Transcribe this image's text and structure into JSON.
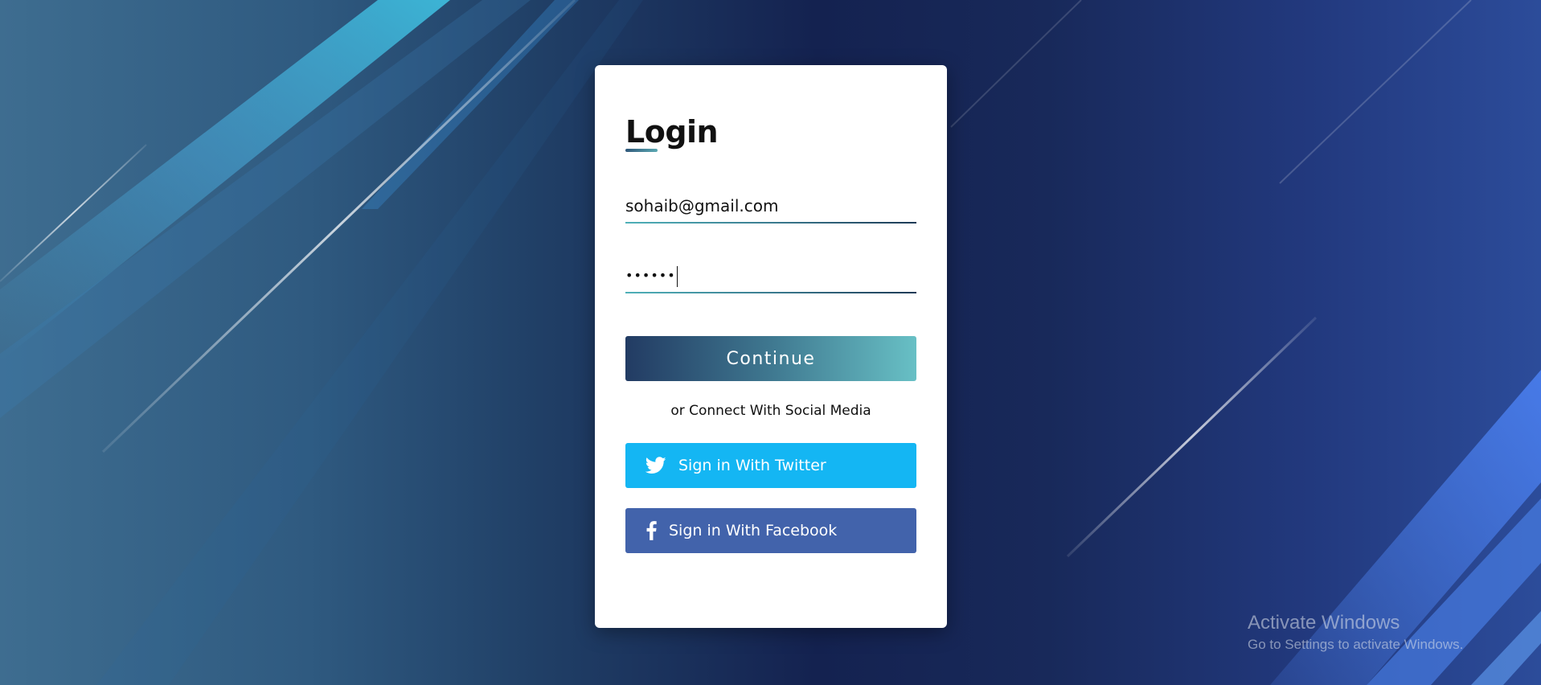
{
  "login": {
    "title": "Login",
    "email_value": "sohaib@gmail.com",
    "password_masked": "••••••",
    "continue_label": "Continue",
    "social_text": "or Connect With Social Media",
    "twitter_label": "Sign in With Twitter",
    "facebook_label": "Sign in With Facebook"
  },
  "icons": {
    "twitter": "twitter-icon",
    "facebook": "facebook-icon"
  },
  "colors": {
    "twitter": "#14b6f3",
    "facebook": "#4263ab",
    "continue_start": "#223b63",
    "continue_end": "#68c0c5"
  },
  "watermark": {
    "title": "Activate Windows",
    "subtitle": "Go to Settings to activate Windows."
  }
}
